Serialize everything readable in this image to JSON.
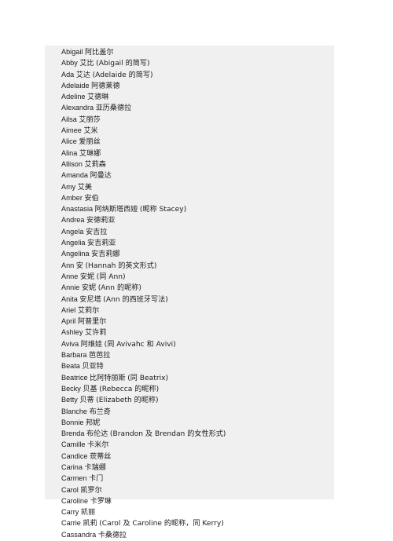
{
  "document": {
    "background_color": "#ffffff",
    "sheet_color": "#f0f0f0",
    "text_color": "#1a1a1a",
    "entries": [
      {
        "en": "Abigail",
        "cn": "阿比盖尔",
        "note": ""
      },
      {
        "en": "Abby",
        "cn": "艾比",
        "note": "(Abigail 的简写)"
      },
      {
        "en": "Ada",
        "cn": "艾达",
        "note": "(Adelaide 的简写)"
      },
      {
        "en": "Adelaide",
        "cn": "阿德莱德",
        "note": ""
      },
      {
        "en": "Adeline",
        "cn": "艾德琳",
        "note": ""
      },
      {
        "en": "Alexandra",
        "cn": "亚历桑德拉",
        "note": ""
      },
      {
        "en": "Ailsa",
        "cn": "艾丽莎",
        "note": ""
      },
      {
        "en": "Aimee",
        "cn": "艾米",
        "note": ""
      },
      {
        "en": "Alice",
        "cn": "爱丽丝",
        "note": ""
      },
      {
        "en": "Alina",
        "cn": "艾琳娜",
        "note": ""
      },
      {
        "en": "Allison",
        "cn": "艾莉森",
        "note": ""
      },
      {
        "en": "Amanda",
        "cn": "阿曼达",
        "note": ""
      },
      {
        "en": "Amy",
        "cn": "艾美",
        "note": ""
      },
      {
        "en": "Amber",
        "cn": "安伯",
        "note": ""
      },
      {
        "en": "Anastasia",
        "cn": "阿纳斯塔西娅",
        "note": "(昵称 Stacey)"
      },
      {
        "en": "Andrea",
        "cn": "安德莉亚",
        "note": ""
      },
      {
        "en": "Angela",
        "cn": "安吉拉",
        "note": ""
      },
      {
        "en": "Angelia",
        "cn": "安吉莉亚",
        "note": ""
      },
      {
        "en": "Angelina",
        "cn": "安吉莉娜",
        "note": ""
      },
      {
        "en": "Ann",
        "cn": "安",
        "note": "(Hannah 的英文形式)"
      },
      {
        "en": "Anne",
        "cn": "安妮",
        "note": "(同 Ann)"
      },
      {
        "en": "Annie",
        "cn": "安妮",
        "note": "(Ann 的昵称)"
      },
      {
        "en": "Anita",
        "cn": "安尼塔",
        "note": "(Ann 的西班牙写法)"
      },
      {
        "en": "Ariel",
        "cn": "艾莉尔",
        "note": ""
      },
      {
        "en": "April",
        "cn": "阿普里尔",
        "note": ""
      },
      {
        "en": "Ashley",
        "cn": "艾许莉",
        "note": ""
      },
      {
        "en": "Aviva",
        "cn": "阿维娃",
        "note": "(同 Avivahc 和 Avivi)"
      },
      {
        "en": "Barbara",
        "cn": "芭芭拉",
        "note": ""
      },
      {
        "en": "Beata",
        "cn": "贝亚特",
        "note": ""
      },
      {
        "en": "Beatrice",
        "cn": "比阿特丽斯",
        "note": "(同 Beatrix)"
      },
      {
        "en": "Becky",
        "cn": "贝基",
        "note": "(Rebecca 的昵称)"
      },
      {
        "en": "Betty",
        "cn": "贝蒂",
        "note": "(Elizabeth 的昵称)"
      },
      {
        "en": "Blanche",
        "cn": "布兰奇",
        "note": ""
      },
      {
        "en": "Bonnie",
        "cn": "邦妮",
        "note": ""
      },
      {
        "en": "Brenda",
        "cn": "布伦达",
        "note": "(Brandon 及 Brendan 的女性形式)"
      },
      {
        "en": "Camille",
        "cn": "卡米尔",
        "note": ""
      },
      {
        "en": "Candice",
        "cn": "莰蒂丝",
        "note": ""
      },
      {
        "en": "Carina",
        "cn": "卡瑞娜",
        "note": ""
      },
      {
        "en": "Carmen",
        "cn": "卡门",
        "note": ""
      },
      {
        "en": "Carol",
        "cn": "凯罗尔",
        "note": ""
      },
      {
        "en": "Caroline",
        "cn": "卡罗琳",
        "note": ""
      },
      {
        "en": "Carry",
        "cn": "凯丽",
        "note": ""
      },
      {
        "en": "Carrie",
        "cn": "凯莉",
        "note": "(Carol 及 Caroline 的昵称，同 Kerry)"
      },
      {
        "en": "Cassandra",
        "cn": "卡桑德拉",
        "note": ""
      }
    ]
  }
}
